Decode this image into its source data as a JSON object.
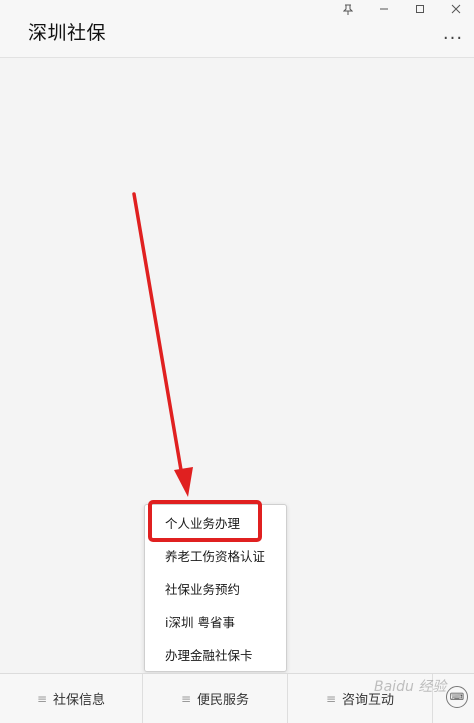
{
  "header": {
    "title": "深圳社保",
    "more_label": "...",
    "window_controls": {
      "pin_icon": "pin-icon",
      "minimize_icon": "minimize-icon",
      "maximize_icon": "maximize-icon",
      "close_icon": "close-icon"
    }
  },
  "popup_menu": {
    "items": [
      {
        "label": "个人业务办理"
      },
      {
        "label": "养老工伤资格认证"
      },
      {
        "label": "社保业务预约"
      },
      {
        "label": "i深圳 粤省事"
      },
      {
        "label": "办理金融社保卡"
      }
    ]
  },
  "tabbar": {
    "tabs": [
      {
        "label": "社保信息"
      },
      {
        "label": "便民服务"
      },
      {
        "label": "咨询互动"
      }
    ],
    "keyboard_icon": "keyboard-icon"
  },
  "annotation": {
    "arrow_color": "#e02020",
    "highlight_color": "#e02020"
  },
  "watermark": "Baidu 经验"
}
